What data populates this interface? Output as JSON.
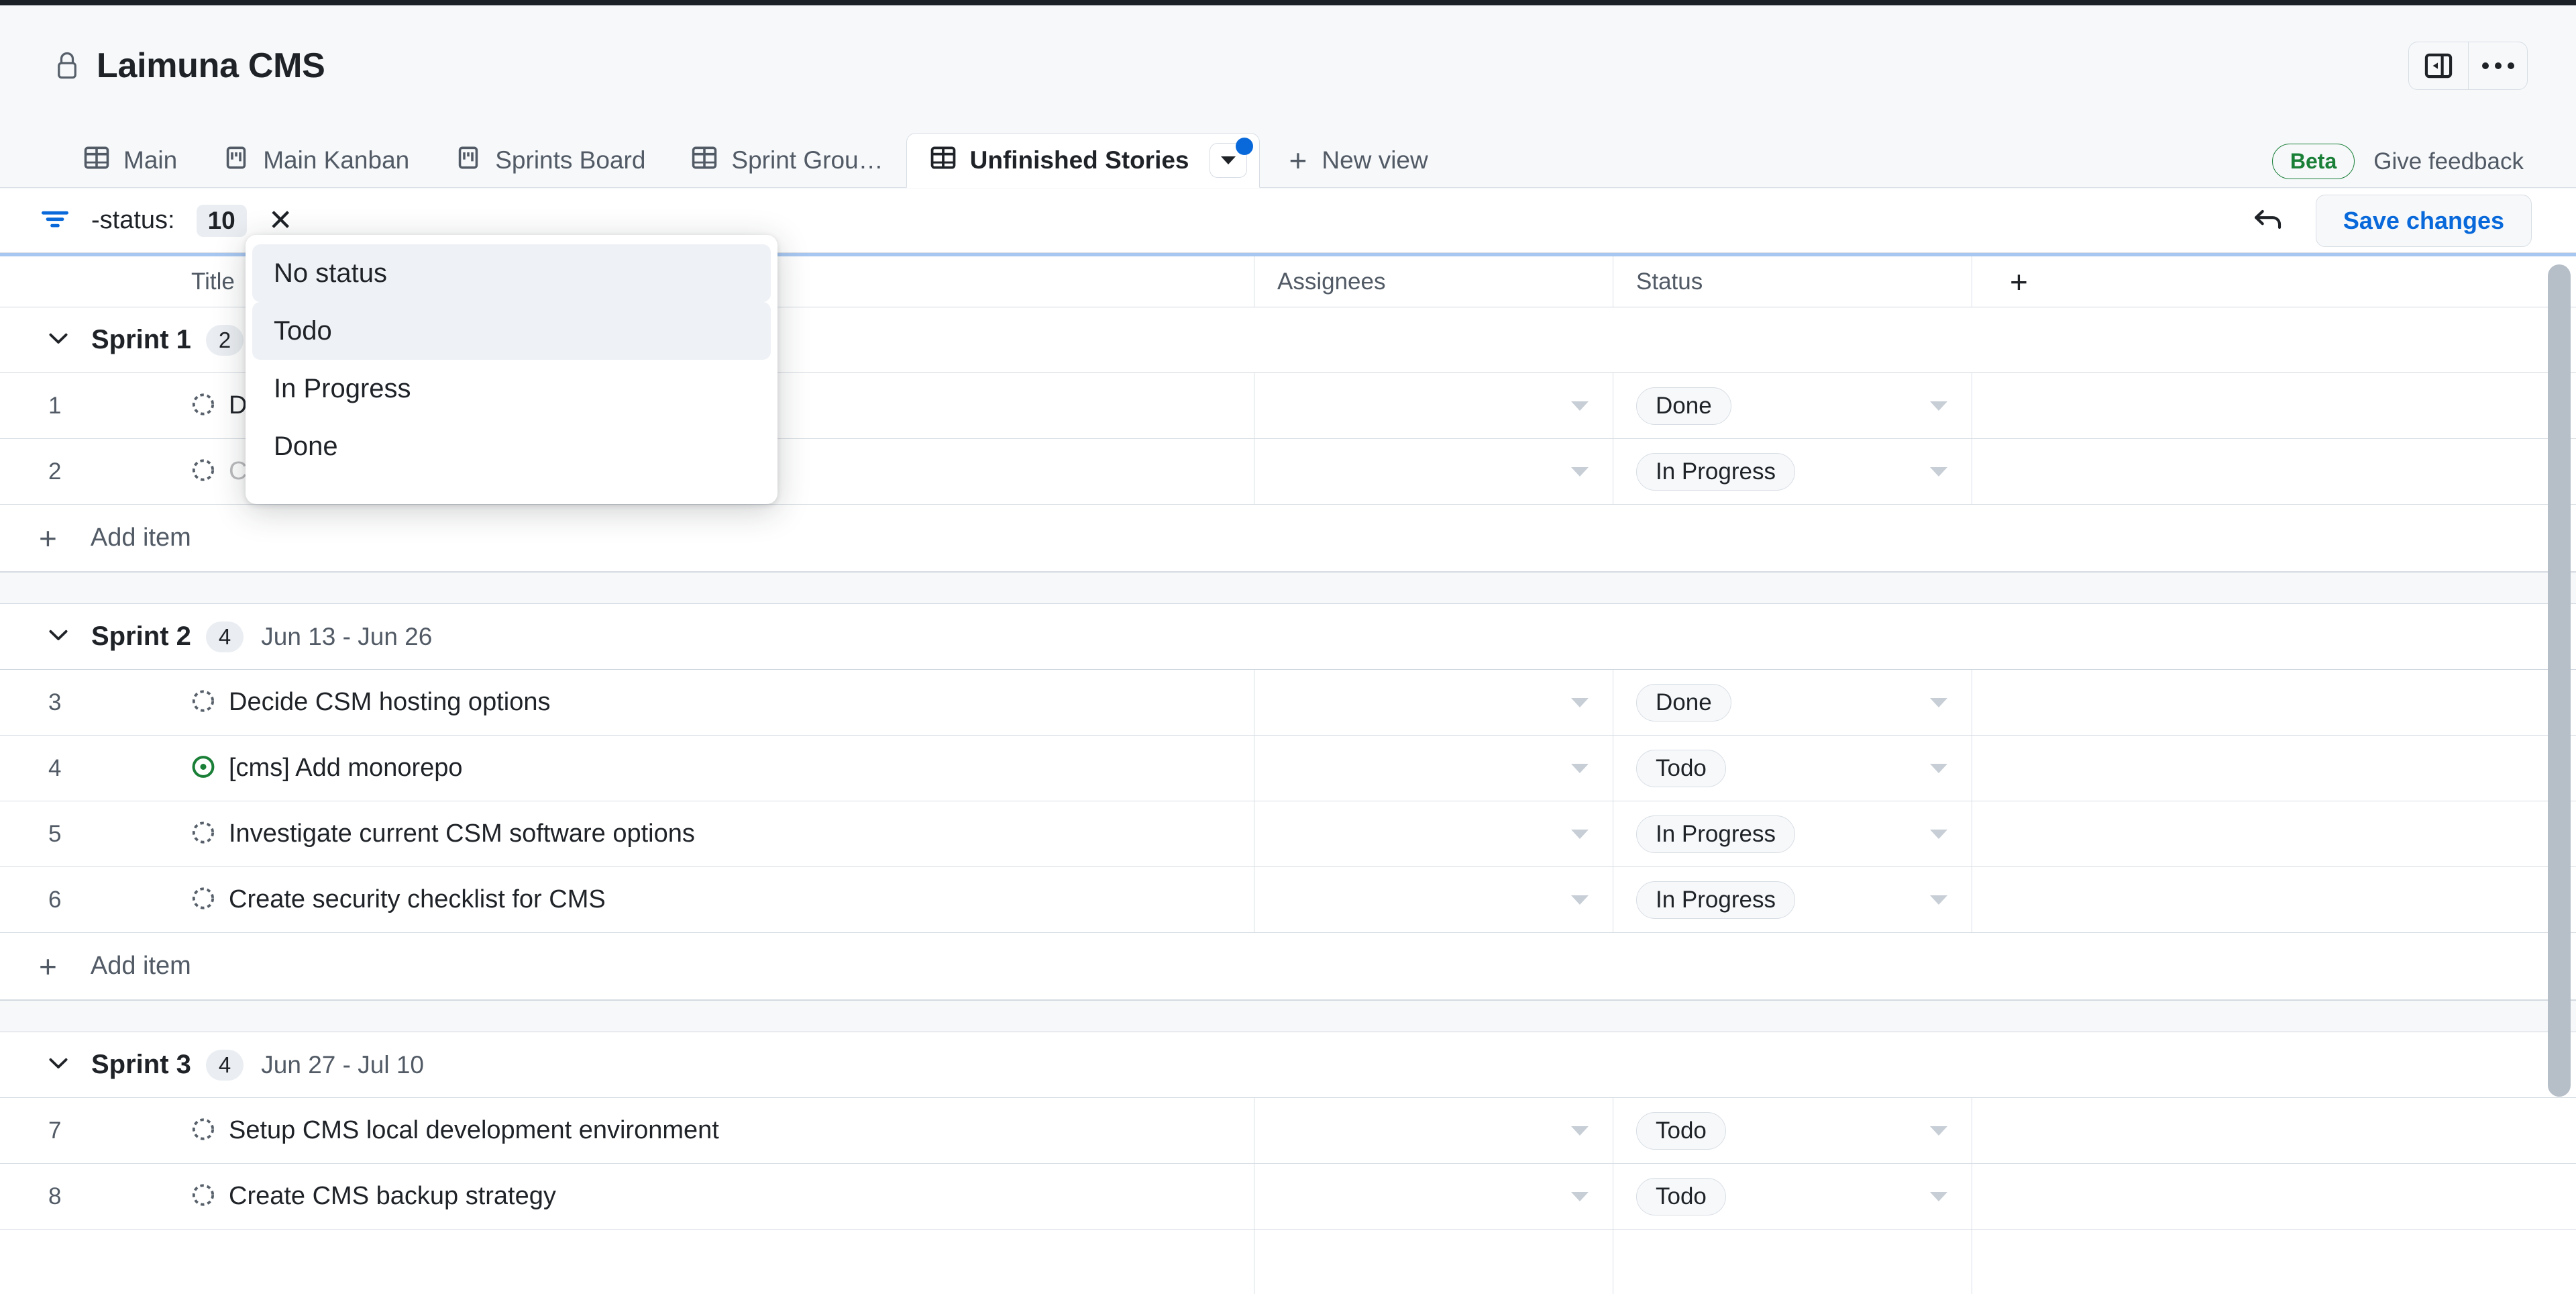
{
  "window": {
    "project_title": "Laimuna CMS",
    "lock_icon": "lock-icon",
    "sidebar_toggle_icon": "sidebar-collapse-icon",
    "more_icon": "kebab-menu-icon"
  },
  "tabs": {
    "items": [
      {
        "label": "Main",
        "icon": "table-view-icon",
        "active": false
      },
      {
        "label": "Main Kanban",
        "icon": "board-view-icon",
        "active": false
      },
      {
        "label": "Sprints Board",
        "icon": "board-view-icon",
        "active": false
      },
      {
        "label": "Sprint Grou…",
        "icon": "table-view-icon",
        "active": false
      },
      {
        "label": "Unfinished Stories",
        "icon": "table-view-icon",
        "active": true
      }
    ],
    "new_view_label": "New view",
    "new_view_icon": "plus-icon",
    "active_tab_caret_icon": "chevron-down-icon",
    "unsaved_badge_color": "#0969da",
    "beta_label": "Beta",
    "beta_color": "#1a7f37",
    "feedback_label": "Give feedback"
  },
  "filter_bar": {
    "filter_icon": "filter-icon",
    "filter_icon_color": "#0969da",
    "query": "-status:",
    "count": "10",
    "clear_icon": "close-icon",
    "undo_icon": "undo-arrow-icon",
    "save_label": "Save changes",
    "save_color": "#0969da"
  },
  "dropdown": {
    "options": [
      {
        "label": "No status",
        "selected": true
      },
      {
        "label": "Todo",
        "selected": true
      },
      {
        "label": "In Progress",
        "selected": false
      },
      {
        "label": "Done",
        "selected": false
      }
    ]
  },
  "table": {
    "columns": [
      "Title",
      "Assignees",
      "Status"
    ],
    "add_column_icon": "plus-icon",
    "add_item_label": "Add item",
    "add_item_icon": "plus-icon",
    "collapse_icon": "chevron-down-icon",
    "groups": [
      {
        "name": "Sprint 1",
        "count": "2",
        "dates": "",
        "rows": [
          {
            "num": "1",
            "title": "Decide",
            "title_hidden_tail": "",
            "icon": "draft-issue-icon",
            "assignees": "",
            "status": "Done",
            "obscured": false
          },
          {
            "num": "2",
            "title": "Confirm requirements with business team",
            "icon": "draft-issue-icon",
            "assignees": "",
            "status": "In Progress",
            "obscured": true
          }
        ]
      },
      {
        "name": "Sprint 2",
        "count": "4",
        "dates": "Jun 13 - Jun 26",
        "rows": [
          {
            "num": "3",
            "title": "Decide CSM hosting options",
            "icon": "draft-issue-icon",
            "assignees": "",
            "status": "Done",
            "obscured": false
          },
          {
            "num": "4",
            "title": "[cms] Add monorepo",
            "icon": "open-issue-icon",
            "assignees": "",
            "status": "Todo",
            "obscured": false
          },
          {
            "num": "5",
            "title": "Investigate current CSM software options",
            "icon": "draft-issue-icon",
            "assignees": "",
            "status": "In Progress",
            "obscured": false
          },
          {
            "num": "6",
            "title": "Create security checklist for CMS",
            "icon": "draft-issue-icon",
            "assignees": "",
            "status": "In Progress",
            "obscured": false
          }
        ]
      },
      {
        "name": "Sprint 3",
        "count": "4",
        "dates": "Jun 27 - Jul 10",
        "rows": [
          {
            "num": "7",
            "title": "Setup CMS local development environment",
            "icon": "draft-issue-icon",
            "assignees": "",
            "status": "Todo",
            "obscured": false
          },
          {
            "num": "8",
            "title": "Create CMS backup strategy",
            "icon": "draft-issue-icon",
            "assignees": "",
            "status": "Todo",
            "obscured": false
          }
        ]
      }
    ]
  },
  "colors": {
    "accent_blue": "#0969da",
    "green": "#1a7f37",
    "page_bg": "#f6f8fa",
    "border": "#d8dee4"
  }
}
